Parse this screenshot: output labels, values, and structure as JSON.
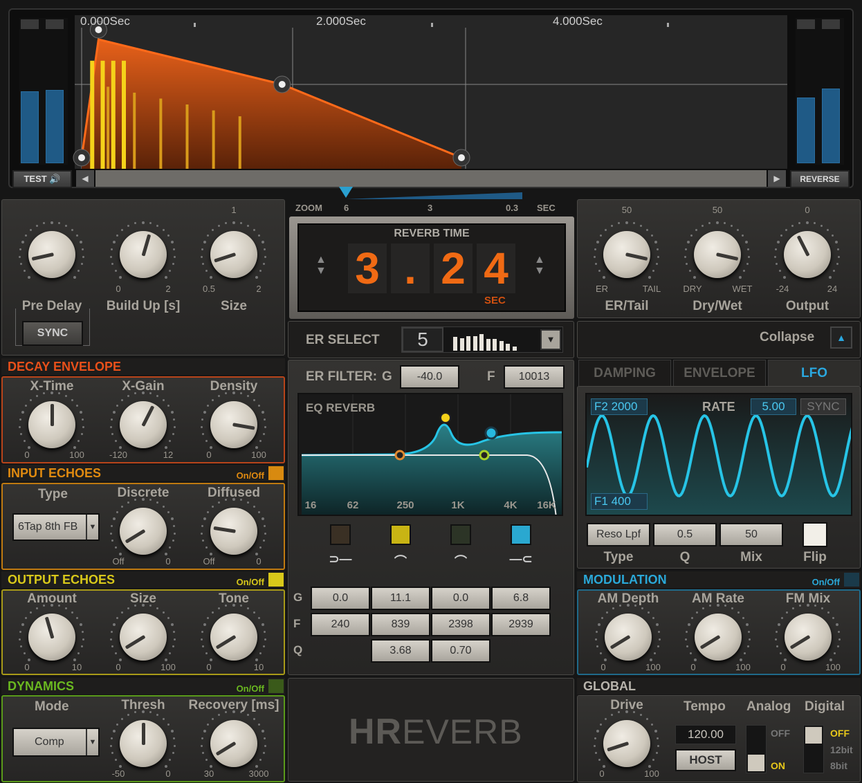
{
  "display": {
    "time_labels": [
      "0.000Sec",
      "2.000Sec",
      "4.000Sec"
    ],
    "test_label": "TEST",
    "reverse_label": "REVERSE",
    "meters_in": [
      0.55,
      0.56
    ],
    "meters_out": [
      0.5,
      0.57
    ],
    "envelope_points": [
      [
        0,
        0
      ],
      [
        0.16,
        1
      ],
      [
        1.9,
        0.62
      ],
      [
        3.6,
        0
      ]
    ],
    "er_taps": {
      "primary": [
        0.1,
        0.2,
        0.3,
        0.4
      ],
      "primary_level": 0.82,
      "secondary": [
        0.25,
        0.5,
        0.75,
        1.0,
        1.25,
        1.5
      ],
      "secondary_levels": [
        0.6,
        0.55,
        0.5,
        0.45,
        0.4,
        0.35
      ]
    },
    "colors": {
      "envelope": "#e8611a",
      "taps": "#f5d21a",
      "meter": "#1f5a86"
    }
  },
  "zoom": {
    "label": "ZOOM",
    "ticks": [
      "6",
      "3",
      "0.3"
    ],
    "unit": "SEC",
    "value": 6
  },
  "reverb_time": {
    "title": "REVERB TIME",
    "digits": [
      "3",
      ".",
      "2",
      "4"
    ],
    "unit": "SEC"
  },
  "left": {
    "knobs": [
      {
        "label": "Pre Delay",
        "value": 0.12,
        "min": "",
        "max": ""
      },
      {
        "label": "Build Up [s]",
        "value": 0.56,
        "min": "0",
        "max": "2"
      },
      {
        "label": "Size",
        "value": 0.1,
        "min": "0.5",
        "max": "2",
        "top": "1"
      }
    ],
    "sync": "SYNC"
  },
  "right": {
    "knobs": [
      {
        "label": "ER/Tail",
        "value": 0.88,
        "min": "ER",
        "max": "TAIL",
        "top": "50"
      },
      {
        "label": "Dry/Wet",
        "value": 0.88,
        "min": "DRY",
        "max": "WET",
        "top": "50"
      },
      {
        "label": "Output",
        "value": 0.4,
        "min": "-24",
        "max": "24",
        "top": "0"
      }
    ],
    "collapse": "Collapse"
  },
  "decay": {
    "title": "DECAY ENVELOPE",
    "knobs": [
      {
        "label": "X-Time",
        "value": 0.5,
        "min": "0",
        "max": "100"
      },
      {
        "label": "X-Gain",
        "value": 0.6,
        "min": "-120",
        "max": "12"
      },
      {
        "label": "Density",
        "value": 0.87,
        "min": "0",
        "max": "100"
      }
    ]
  },
  "input_echoes": {
    "title": "INPUT ECHOES",
    "onoff": "On/Off",
    "type_label": "Type",
    "type_value": "6Tap 8th FB",
    "knobs": [
      {
        "label": "Discrete",
        "value": 0.05,
        "min": "Off",
        "max": "0"
      },
      {
        "label": "Diffused",
        "value": 0.2,
        "min": "Off",
        "max": "0"
      }
    ]
  },
  "output_echoes": {
    "title": "OUTPUT ECHOES",
    "onoff": "On/Off",
    "knobs": [
      {
        "label": "Amount",
        "value": 0.44,
        "min": "0",
        "max": "10"
      },
      {
        "label": "Size",
        "value": 0.05,
        "min": "0",
        "max": "100"
      },
      {
        "label": "Tone",
        "value": 0.05,
        "min": "0",
        "max": "10"
      }
    ]
  },
  "dynamics": {
    "title": "DYNAMICS",
    "onoff": "On/Off",
    "mode_label": "Mode",
    "mode_value": "Comp",
    "knobs": [
      {
        "label": "Thresh",
        "value": 0.5,
        "min": "-50",
        "max": "0"
      },
      {
        "label": "Recovery [ms]",
        "value": 0.05,
        "min": "30",
        "max": "3000"
      }
    ]
  },
  "er_select": {
    "label": "ER SELECT",
    "value": "5",
    "pattern": [
      0.7,
      0.65,
      0.75,
      0.75,
      0.85,
      0.6,
      0.6,
      0.5,
      0.35,
      0.2
    ]
  },
  "er_filter": {
    "label": "ER FILTER:",
    "g_label": "G",
    "g_value": "-40.0",
    "f_label": "F",
    "f_value": "10013"
  },
  "eq": {
    "title": "EQ REVERB",
    "freq_labels": [
      "16",
      "62",
      "250",
      "1K",
      "4K",
      "16K"
    ],
    "bands": [
      {
        "type": "low-shelf",
        "color": "#3a3024",
        "g": "0.0",
        "f": "240",
        "q": ""
      },
      {
        "type": "peak",
        "color": "#c8b414",
        "g": "11.1",
        "f": "839",
        "q": "3.68"
      },
      {
        "type": "peak",
        "color": "#2c3426",
        "g": "0.0",
        "f": "2398",
        "q": "0.70"
      },
      {
        "type": "high-shelf",
        "color": "#2aa8d0",
        "g": "6.8",
        "f": "2939",
        "q": ""
      }
    ],
    "row_labels": [
      "G",
      "F",
      "Q"
    ]
  },
  "logo": "HREVERB",
  "tabs": [
    {
      "label": "DAMPING",
      "active": false
    },
    {
      "label": "ENVELOPE",
      "active": false
    },
    {
      "label": "LFO",
      "active": true
    }
  ],
  "lfo": {
    "f2_label": "F2",
    "f2_value": "2000",
    "f1_label": "F1",
    "f1_value": "400",
    "rate_label": "RATE",
    "rate_value": "5.00",
    "sync": "SYNC",
    "type_value": "Reso Lpf",
    "q_value": "0.5",
    "mix_value": "50",
    "labels": [
      "Type",
      "Q",
      "Mix",
      "Flip"
    ]
  },
  "modulation": {
    "title": "MODULATION",
    "onoff": "On/Off",
    "knobs": [
      {
        "label": "AM Depth",
        "value": 0.05,
        "min": "0",
        "max": "100"
      },
      {
        "label": "AM Rate",
        "value": 0.05,
        "min": "0",
        "max": "100"
      },
      {
        "label": "FM Mix",
        "value": 0.05,
        "min": "0",
        "max": "100"
      }
    ]
  },
  "global": {
    "title": "GLOBAL",
    "drive": {
      "label": "Drive",
      "value": 0.1,
      "min": "0",
      "max": "100"
    },
    "tempo_label": "Tempo",
    "tempo_value": "120.00",
    "host": "HOST",
    "analog_label": "Analog",
    "analog_off": "OFF",
    "analog_on": "ON",
    "analog_state": "ON",
    "digital_label": "Digital",
    "digital_options": [
      "OFF",
      "12bit",
      "8bit"
    ],
    "digital_state": "OFF"
  }
}
